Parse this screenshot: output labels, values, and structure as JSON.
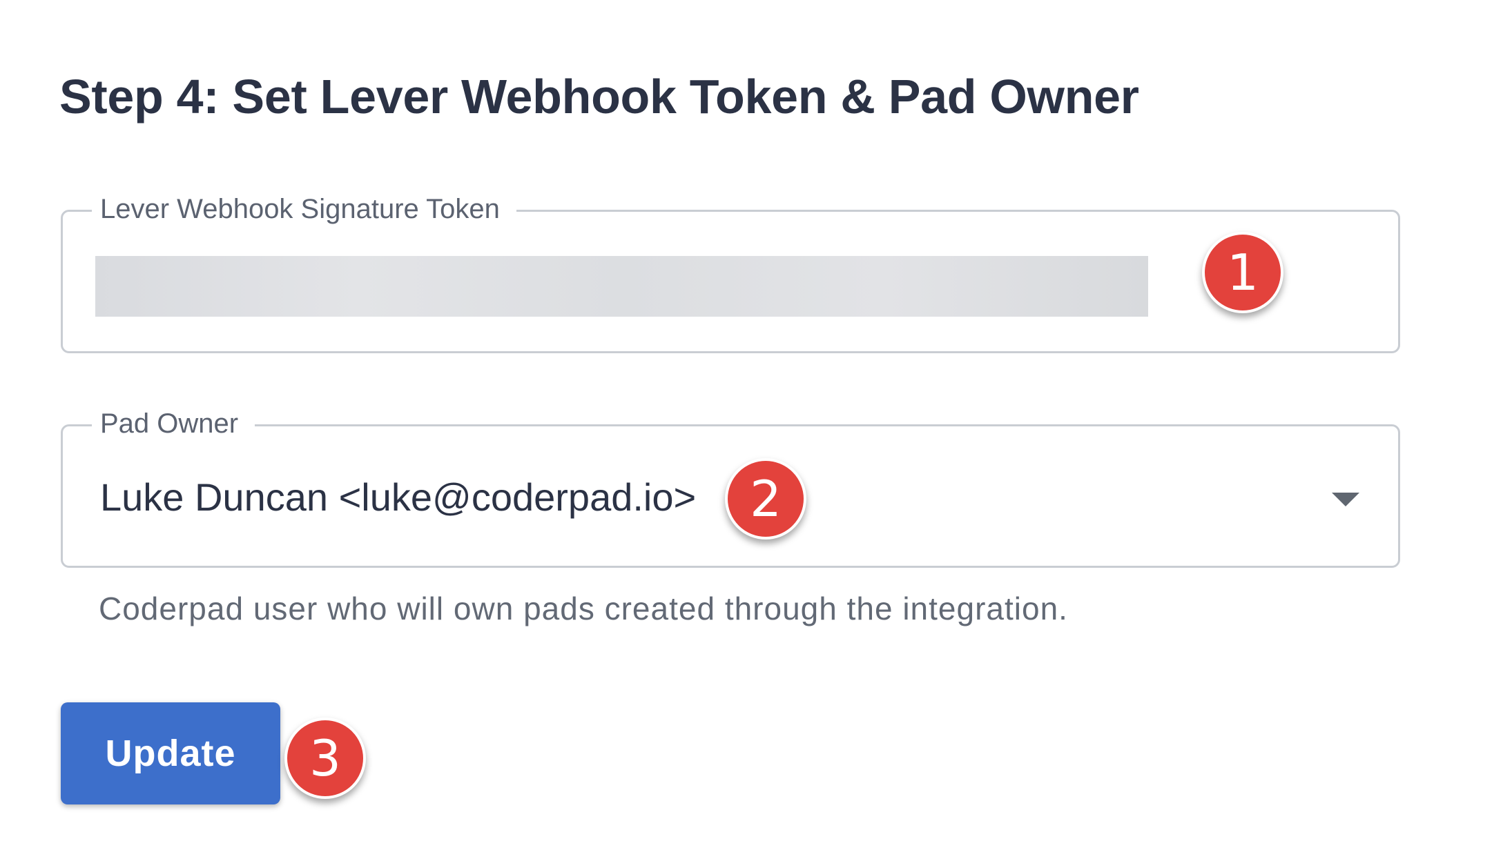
{
  "page": {
    "title": "Step 4: Set Lever Webhook Token & Pad Owner"
  },
  "token_field": {
    "label": "Lever Webhook Signature Token"
  },
  "pad_owner_field": {
    "label": "Pad Owner",
    "selected_value": "Luke Duncan <luke@coderpad.io>",
    "helper_text": "Coderpad user who will own pads created through the integration."
  },
  "actions": {
    "update_label": "Update"
  },
  "callouts": [
    "1",
    "2",
    "3"
  ],
  "colors": {
    "primary_button": "#3d6fcb",
    "callout_red": "#e3423c",
    "field_border": "#c9cdd3",
    "title_text": "#2b3245"
  }
}
